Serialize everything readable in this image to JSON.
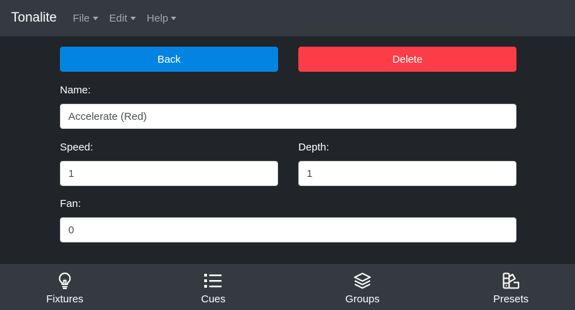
{
  "navbar": {
    "brand": "Tonalite",
    "menu": [
      {
        "label": "File"
      },
      {
        "label": "Edit"
      },
      {
        "label": "Help"
      }
    ]
  },
  "actions": {
    "back_label": "Back",
    "delete_label": "Delete"
  },
  "form": {
    "name": {
      "label": "Name:",
      "value": "Accelerate (Red)"
    },
    "speed": {
      "label": "Speed:",
      "value": "1"
    },
    "depth": {
      "label": "Depth:",
      "value": "1"
    },
    "fan": {
      "label": "Fan:",
      "value": "0"
    }
  },
  "tabs": [
    {
      "label": "Fixtures",
      "icon": "lightbulb-icon"
    },
    {
      "label": "Cues",
      "icon": "list-icon"
    },
    {
      "label": "Groups",
      "icon": "layers-icon"
    },
    {
      "label": "Presets",
      "icon": "palette-icon"
    }
  ],
  "colors": {
    "background": "#212529",
    "navbar": "#343a40",
    "primary": "#0384e2",
    "danger": "#fc3d47"
  }
}
